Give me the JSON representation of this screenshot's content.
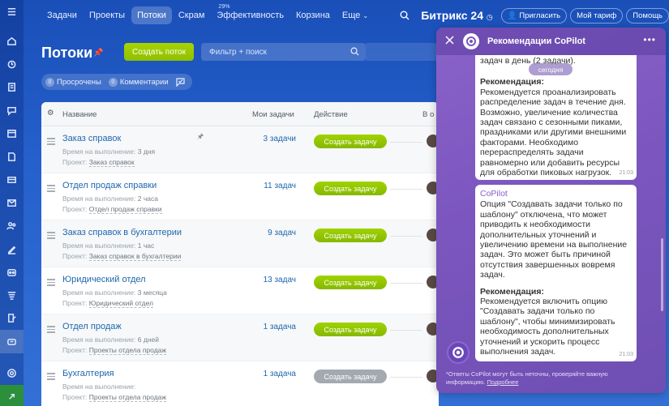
{
  "topbar": {
    "nav": [
      {
        "label": "Задачи",
        "active": false
      },
      {
        "label": "Проекты",
        "active": false
      },
      {
        "label": "Потоки",
        "active": true
      },
      {
        "label": "Скрам",
        "active": false
      },
      {
        "label": "Эффективность",
        "active": false,
        "sup": "29%"
      },
      {
        "label": "Корзина",
        "active": false
      },
      {
        "label": "Еще",
        "active": false
      }
    ],
    "brand": "Битрикс 24",
    "invite": "Пригласить",
    "tariff": "Мой тариф",
    "help": "Помощь"
  },
  "page": {
    "title": "Потоки",
    "create_button": "Создать поток",
    "filter_placeholder": "Фильтр + поиск",
    "counters": [
      {
        "count": "0",
        "label": "Просрочены"
      },
      {
        "count": "0",
        "label": "Комментарии"
      }
    ]
  },
  "grid": {
    "columns": {
      "name": "Название",
      "my_tasks": "Мои задачи",
      "action": "Действие",
      "more": "В о"
    },
    "rows": [
      {
        "name": "Заказ справок",
        "time_label": "Время на выполнение:",
        "time": "3 дня",
        "project_label": "Проект:",
        "project": "Заказ справок",
        "tasks": "3 задачи",
        "action": "Создать задачу",
        "enabled": true
      },
      {
        "name": "Отдел продаж справки",
        "time_label": "Время на выполнение:",
        "time": "2 часа",
        "project_label": "Проект:",
        "project": "Отдел продаж справки",
        "tasks": "11 задач",
        "action": "Создать задачу",
        "enabled": true
      },
      {
        "name": "Заказ справок в бухгалтерии",
        "time_label": "Время на выполнение:",
        "time": "1 час",
        "project_label": "Проект:",
        "project": "Заказ справок в бухгалтерии",
        "tasks": "9 задач",
        "action": "Создать задачу",
        "enabled": true
      },
      {
        "name": "Юридический отдел",
        "time_label": "Время на выполнение:",
        "time": "3 месяца",
        "project_label": "Проект:",
        "project": "Юридический отдел",
        "tasks": "13 задач",
        "action": "Создать задачу",
        "enabled": true
      },
      {
        "name": "Отдел продаж",
        "time_label": "Время на выполнение:",
        "time": "6 дней",
        "project_label": "Проект:",
        "project": "Проекты отдела продаж",
        "tasks": "1 задача",
        "action": "Создать задачу",
        "enabled": true
      },
      {
        "name": "Бухгалтерия",
        "time_label": "Время на выполнение:",
        "time": "",
        "project_label": "Проект:",
        "project": "Проекты отдела продаж",
        "tasks": "1 задача",
        "action": "Создать задачу",
        "enabled": false
      }
    ]
  },
  "copilot": {
    "title": "Рекомендации CoPilot",
    "today": "сегодня",
    "msg1": {
      "intro": "задач в день (2 задачи).",
      "heading": "Рекомендация:",
      "body": "Рекомендуется проанализировать распределение задач в течение дня. Возможно, увеличение количества задач связано с сезонными пиками, праздниками или другими внешними факторами. Необходимо перераспределять задачи равномерно или добавить ресурсы для обработки пиковых нагрузок.",
      "time": "21:03"
    },
    "msg2": {
      "author": "CoPilot",
      "body": "Опция \"Создавать задачи только по шаблону\" отключена, что может приводить к необходимости дополнительных уточнений и увеличению времени на выполнение задач. Это может быть причиной отсутствия завершенных вовремя задач.",
      "heading": "Рекомендация:",
      "rec": "Рекомендуется включить опцию \"Создавать задачи только по шаблону\", чтобы минимизировать необходимость дополнительных уточнений и ускорить процесс выполнения задач.",
      "time": "21:03"
    },
    "disclaimer": "*Ответы CoPilot могут быть неточны, проверяйте важную информацию.",
    "more_link": "Подробнее"
  },
  "colors": {
    "accent_green": "#9dcf00",
    "link": "#2067b0",
    "copilot_purple": "#7b56be"
  }
}
